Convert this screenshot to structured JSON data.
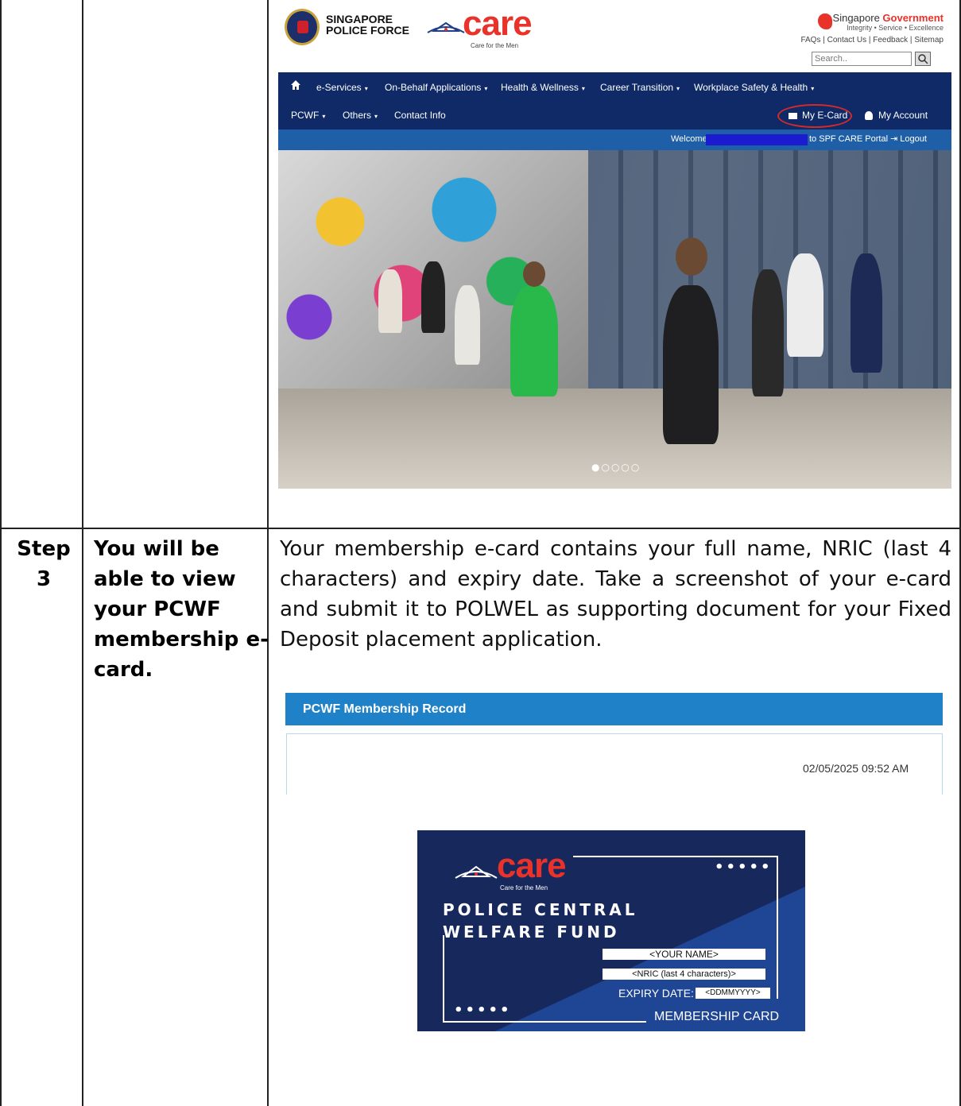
{
  "step": {
    "label": "Step 3",
    "title": "You will be able to view your PCWF membership e-card.",
    "description": "Your membership e-card contains your full name, NRIC (last 4 characters) and expiry date. Take a screenshot of your e-card and submit it to POLWEL as supporting document for your Fixed Deposit placement application."
  },
  "portal": {
    "spf_name": "SINGAPORE POLICE FORCE",
    "care_logo": "care",
    "care_tagline": "Care for the Men",
    "gov_title_prefix": "Singapore ",
    "gov_title_suffix": "Government",
    "gov_tagline": "Integrity • Service • Excellence",
    "top_links": [
      "FAQs",
      "Contact Us",
      "Feedback",
      "Sitemap"
    ],
    "search_placeholder": "Search..",
    "nav_row1": [
      "e-Services",
      "On-Behalf Applications",
      "Health & Wellness",
      "Career Transition",
      "Workplace Safety & Health"
    ],
    "nav_row2": [
      "PCWF",
      "Others",
      "Contact Info"
    ],
    "ecard": "My E-Card",
    "account": "My Account",
    "welcome": "Welcome",
    "portal_suffix": "to SPF CARE Portal",
    "logout": "Logout",
    "slider_dots": "●○○○○"
  },
  "record": {
    "header": "PCWF Membership Record",
    "datetime": "02/05/2025 09:52 AM",
    "card": {
      "care": "care",
      "care_sub": "Care for the Men",
      "fund_line1": "POLICE CENTRAL",
      "fund_line2": "WELFARE FUND",
      "name": "<YOUR NAME>",
      "nric": "<NRIC (last 4 characters)>",
      "expiry_label": "EXPIRY DATE:",
      "expiry_value": "<DDMMYYYY>",
      "type": "MEMBERSHIP CARD",
      "dots": "•••••"
    }
  },
  "colors": {
    "nav_bg": "#0f2a66",
    "welcome_bg": "#1e5fa8",
    "record_header": "#1f82c8",
    "care_red": "#e8322a",
    "card_bg": "#16285c"
  }
}
